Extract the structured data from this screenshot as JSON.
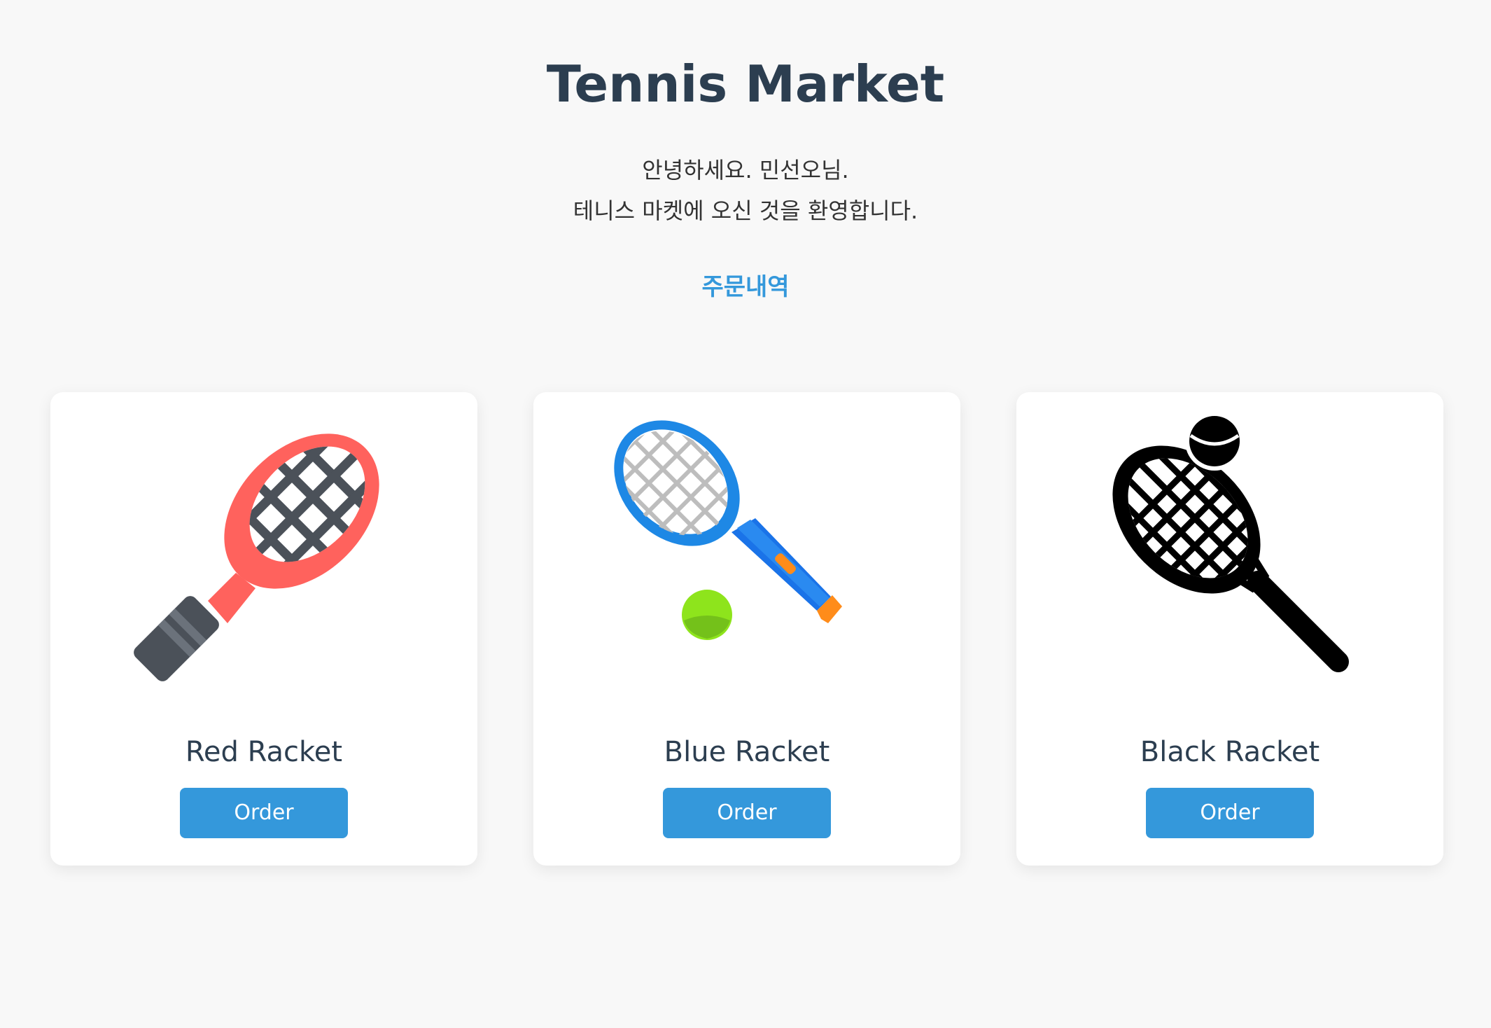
{
  "header": {
    "title": "Tennis Market",
    "greeting_line1": "안녕하세요. 민선오님.",
    "greeting_line2": "테니스 마켓에 오신 것을 환영합니다.",
    "orders_link": "주문내역"
  },
  "colors": {
    "background": "#f8f8f8",
    "title": "#2c3e50",
    "link": "#3498db",
    "button": "#3498db",
    "button_text": "#ffffff",
    "card": "#ffffff"
  },
  "products": [
    {
      "name": "Red Racket",
      "button_label": "Order",
      "icon": "red-racket-icon"
    },
    {
      "name": "Blue Racket",
      "button_label": "Order",
      "icon": "blue-racket-icon"
    },
    {
      "name": "Black Racket",
      "button_label": "Order",
      "icon": "black-racket-icon"
    }
  ]
}
